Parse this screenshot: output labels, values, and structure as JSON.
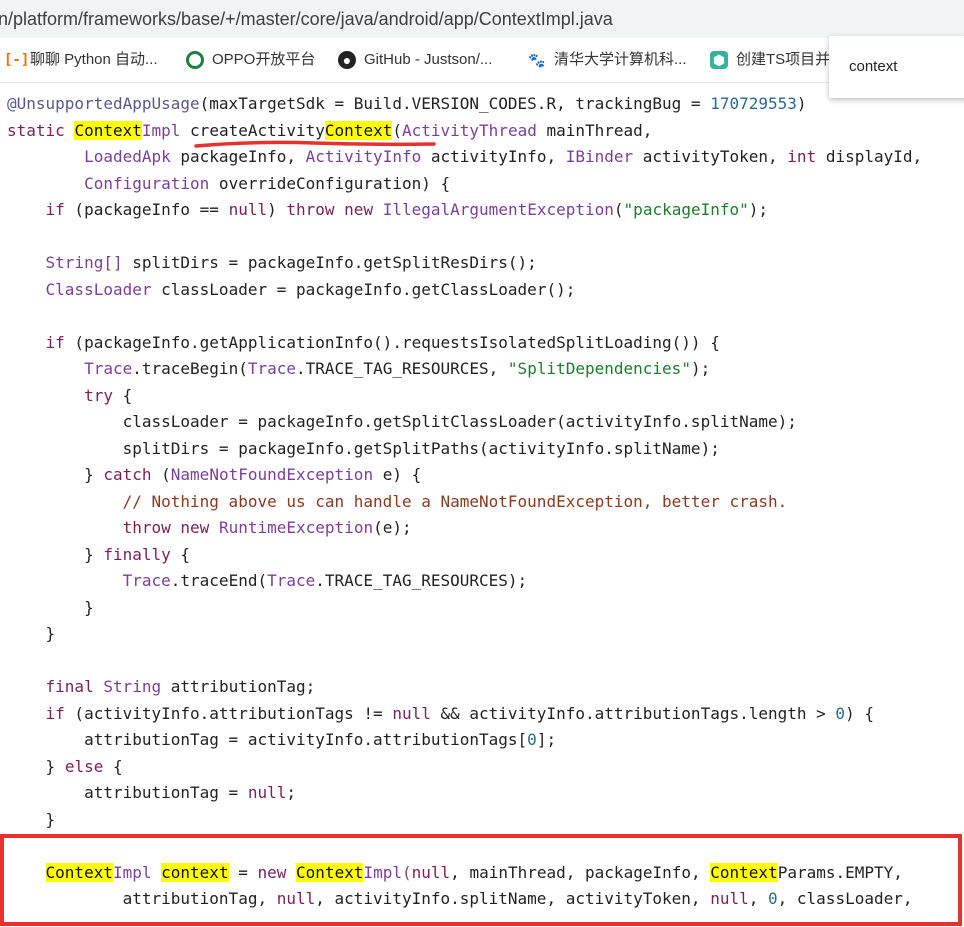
{
  "url": "n/platform/frameworks/base/+/master/core/java/android/app/ContextImpl.java",
  "bookmarks": [
    {
      "label": "聊聊 Python 自动...",
      "icon": "zhihu-icon"
    },
    {
      "label": "OPPO开放平台",
      "icon": "oppo-icon"
    },
    {
      "label": "GitHub - Justson/...",
      "icon": "github-icon"
    },
    {
      "label": "清华大学计算机科...",
      "icon": "baidu-paw-icon"
    },
    {
      "label": "创建TS项目并",
      "icon": "ts-project-icon"
    }
  ],
  "find": {
    "query": "context"
  },
  "code": {
    "annotation": "@UnsupportedAppUsage",
    "annotation_args": "(maxTargetSdk = Build.VERSION_CODES.R, trackingBug = ",
    "annotation_num": "170729553",
    "annotation_close": ")",
    "kw_static": "static",
    "hl_context": "Context",
    "impl": "Impl",
    "method_a": "createActivity",
    "method_paren": "(",
    "activity_thread": "ActivityThread",
    "main_thread": " mainThread,",
    "loaded_apk": "LoadedApk",
    "l3_rest_a": " packageInfo, ",
    "activity_info": "ActivityInfo",
    "l3_rest_b": " activityInfo, ",
    "ibinder": "IBinder",
    "l3_rest_c": " activityToken, ",
    "kw_int": "int",
    "l3_rest_d": " displayId,",
    "configuration": "Configuration",
    "l4_rest": " overrideConfiguration) {",
    "kw_if": "if",
    "l5_a": " (packageInfo == ",
    "kw_null": "null",
    "l5_b": ") ",
    "kw_throw": "throw",
    "kw_new": "new",
    "illegal_arg": "IllegalArgumentException",
    "l5_c": "(",
    "str_packageinfo": "\"packageInfo\"",
    "l5_d": ");",
    "string_arr": "String[]",
    "l7_rest": " splitDirs = packageInfo.getSplitResDirs();",
    "classloader_t": "ClassLoader",
    "l8_rest": " classLoader = packageInfo.getClassLoader();",
    "l10_rest": " (packageInfo.getApplicationInfo().requestsIsolatedSplitLoading()) {",
    "trace": "Trace",
    "l11_a": ".traceBegin(",
    "l11_b": ".TRACE_TAG_RESOURCES, ",
    "str_split": "\"SplitDependencies\"",
    "l11_c": ");",
    "kw_try": "try",
    "brace_open": " {",
    "l13": "classLoader = packageInfo.getSplitClassLoader(activityInfo.splitName);",
    "l14": "splitDirs = packageInfo.getSplitPaths(activityInfo.splitName);",
    "close_brace": "}",
    "kw_catch": "catch",
    "name_not_found": "NameNotFoundException",
    "l15_rest": " e) {",
    "comment": "// Nothing above us can handle a NameNotFoundException, better crash.",
    "runtime_ex": "RuntimeException",
    "l17_rest": "(e);",
    "kw_finally": "finally",
    "l19_a": ".traceEnd(",
    "l19_b": ".TRACE_TAG_RESOURCES);",
    "kw_final": "final",
    "string_t": "String",
    "l23_rest": " attributionTag;",
    "l24_a": " (activityInfo.attributionTags != ",
    "l24_b": " && activityInfo.attributionTags.length > ",
    "num_0": "0",
    "l24_c": ") {",
    "l25_a": "attributionTag = activityInfo.attributionTags[",
    "l25_b": "];",
    "kw_else": "else",
    "l27_a": "attributionTag = ",
    "l27_b": ";",
    "hl_context_lower": "context",
    "l30_a": " = ",
    "l30_b": "Impl(",
    "l30_c": ", mainThread, packageInfo, ",
    "params": "Params.EMPTY,",
    "l31_a": "attributionTag, ",
    "l31_b": ", activityInfo.splitName, activityToken, ",
    "l31_c": ", ",
    "l31_d": ", classLoader,"
  }
}
